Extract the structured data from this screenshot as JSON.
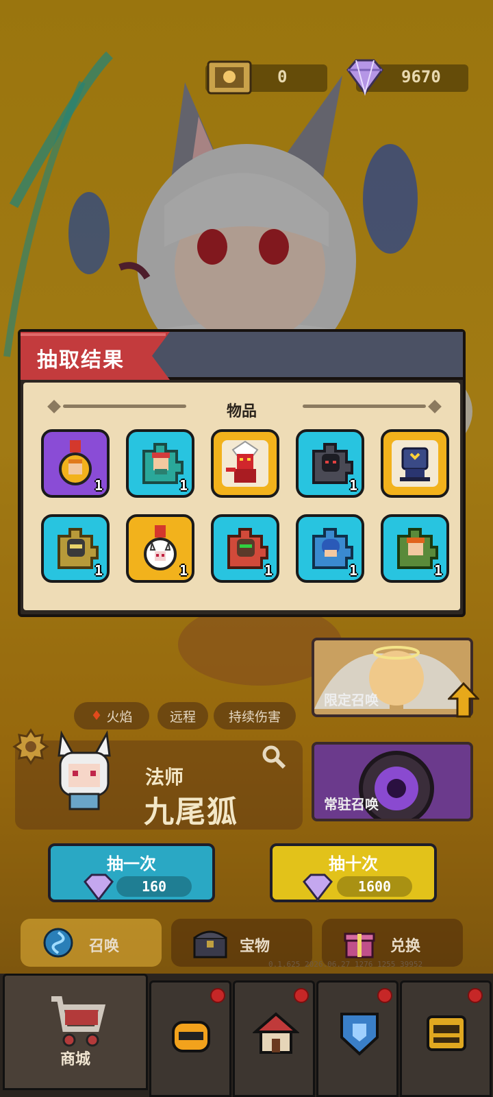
{
  "currency": {
    "tickets": "0",
    "gems": "9670"
  },
  "hero": {
    "tags": [
      "火焰",
      "远程",
      "持续伤害"
    ],
    "role": "法师",
    "name": "九尾狐"
  },
  "summon_panels": {
    "limited": "限定召唤",
    "standard": "常驻召唤"
  },
  "draw": {
    "single": {
      "label": "抽一次",
      "cost": "160"
    },
    "ten": {
      "label": "抽十次",
      "cost": "1600"
    }
  },
  "subtabs": [
    "召唤",
    "宝物",
    "兑换"
  ],
  "debug_text": "0.1.625 2026.06.27 1276 1255 39952",
  "nav": {
    "new_tag": "新",
    "shop_label": "商城"
  },
  "modal": {
    "title": "抽取结果",
    "section": "物品",
    "items": [
      {
        "icon": "medal-hero-icon",
        "frame": "purple",
        "count": "1"
      },
      {
        "icon": "puzzle-shard-red-hair-icon",
        "frame": "cyan",
        "count": "1"
      },
      {
        "icon": "red-demon-hero-icon",
        "frame": "gold",
        "count": ""
      },
      {
        "icon": "puzzle-shard-dark-icon",
        "frame": "cyan",
        "count": "1"
      },
      {
        "icon": "blue-helmet-hero-icon",
        "frame": "gold",
        "count": ""
      },
      {
        "icon": "puzzle-shard-gold-icon",
        "frame": "cyan",
        "count": "1"
      },
      {
        "icon": "medal-fox-icon",
        "frame": "gold",
        "count": "1"
      },
      {
        "icon": "puzzle-shard-red-icon",
        "frame": "cyan",
        "count": "1"
      },
      {
        "icon": "puzzle-shard-blue-icon",
        "frame": "cyan",
        "count": "1"
      },
      {
        "icon": "puzzle-shard-green-icon",
        "frame": "cyan",
        "count": "1"
      }
    ]
  }
}
